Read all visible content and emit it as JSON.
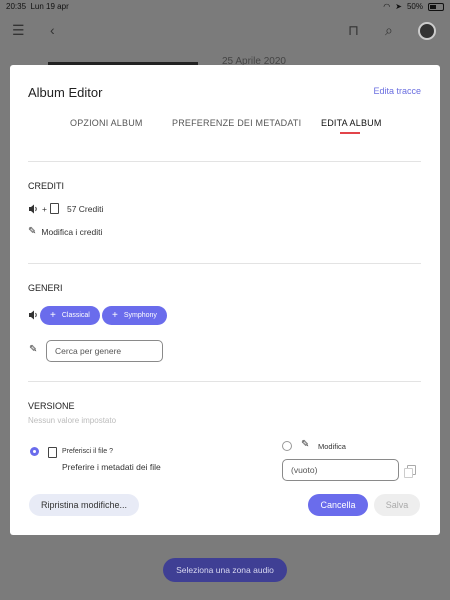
{
  "status_bar": {
    "time": "20:35",
    "date": "Lun 19 apr",
    "battery": "50%",
    "battery_level": 0.5
  },
  "app_bar": {
    "menu_icon": "hamburger-icon",
    "back_icon": "chevron-left-icon",
    "bookmark_icon": "bookmark-icon",
    "search_icon": "search-icon"
  },
  "background": {
    "date_text": "25 Aprile 2020",
    "zone_button": "Seleziona una zona audio"
  },
  "modal": {
    "title": "Album Editor",
    "edit_tracks_link": "Edita tracce",
    "tabs": [
      {
        "label": "OPZIONI ALBUM",
        "active": false
      },
      {
        "label": "PREFERENZE DEI METADATI",
        "active": false
      },
      {
        "label": "EDITA ALBUM",
        "active": true
      }
    ],
    "credits": {
      "heading": "CREDITI",
      "plus": "+",
      "count_label": "57 Crediti",
      "edit_label": "Modifica i crediti"
    },
    "genres": {
      "heading": "GENERI",
      "chips": [
        {
          "plus": "+",
          "label": "Classical"
        },
        {
          "plus": "+",
          "label": "Symphony"
        }
      ],
      "search_placeholder": "Cerca per genere"
    },
    "version": {
      "heading": "VERSIONE",
      "empty_text": "Nessun valore impostato",
      "prefer_file_label": "Preferisci il file ?",
      "prefer_file_desc": "Preferire i metadati dei file",
      "edit_label": "Modifica",
      "edit_value": "(vuoto)"
    },
    "buttons": {
      "reset": "Ripristina modifiche...",
      "cancel": "Cancella",
      "save": "Salva"
    }
  },
  "colors": {
    "accent": "#6a6cec",
    "tab_underline": "#e2444a",
    "overlay": "#7b7b7b",
    "zone_button": "#3f3f94"
  }
}
